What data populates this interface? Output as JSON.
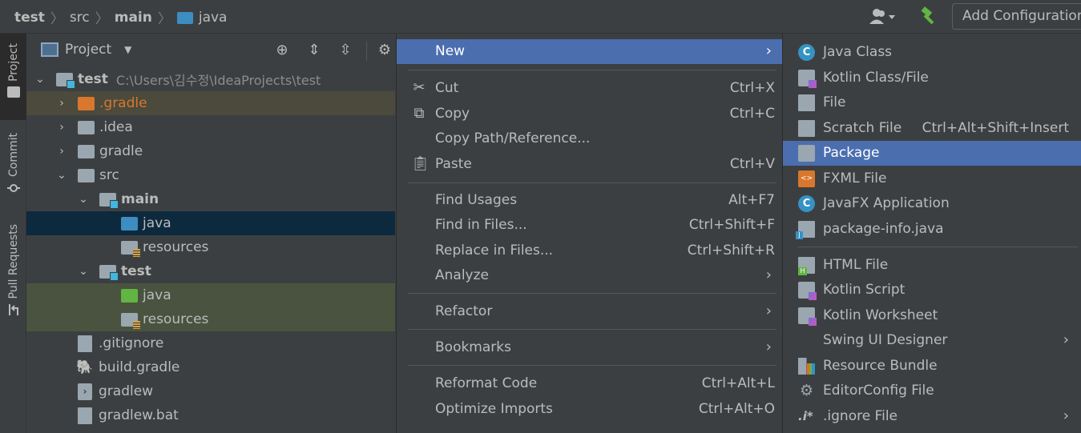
{
  "breadcrumb": {
    "items": [
      {
        "label": "test",
        "bold": true
      },
      {
        "label": "src",
        "bold": false
      },
      {
        "label": "main",
        "bold": true
      },
      {
        "label": "java",
        "bold": false
      }
    ]
  },
  "toolbar": {
    "add_configuration_label": "Add Configuration..."
  },
  "toolstrip": {
    "tabs": [
      "Project",
      "Commit",
      "Pull Requests"
    ]
  },
  "project_panel": {
    "title": "Project",
    "root": {
      "name": "test",
      "path": "C:\\Users\\김수정\\IdeaProjects\\test"
    },
    "items": [
      {
        "name": ".gradle"
      },
      {
        "name": ".idea"
      },
      {
        "name": "gradle"
      },
      {
        "name": "src"
      },
      {
        "name": "main"
      },
      {
        "name": "java"
      },
      {
        "name": "resources"
      },
      {
        "name": "test"
      },
      {
        "name": "java"
      },
      {
        "name": "resources"
      },
      {
        "name": ".gitignore"
      },
      {
        "name": "build.gradle"
      },
      {
        "name": "gradlew"
      },
      {
        "name": "gradlew.bat"
      }
    ]
  },
  "context_menu": {
    "new": "New",
    "cut": {
      "label": "Cut",
      "shortcut": "Ctrl+X"
    },
    "copy": {
      "label": "Copy",
      "shortcut": "Ctrl+C"
    },
    "copy_path": {
      "label": "Copy Path/Reference..."
    },
    "paste": {
      "label": "Paste",
      "shortcut": "Ctrl+V"
    },
    "find_usages": {
      "label": "Find Usages",
      "shortcut": "Alt+F7"
    },
    "find_in_files": {
      "label": "Find in Files...",
      "shortcut": "Ctrl+Shift+F"
    },
    "replace_in_files": {
      "label": "Replace in Files...",
      "shortcut": "Ctrl+Shift+R"
    },
    "analyze": {
      "label": "Analyze"
    },
    "refactor": {
      "label": "Refactor"
    },
    "bookmarks": {
      "label": "Bookmarks"
    },
    "reformat_code": {
      "label": "Reformat Code",
      "shortcut": "Ctrl+Alt+L"
    },
    "optimize_imports": {
      "label": "Optimize Imports",
      "shortcut": "Ctrl+Alt+O"
    }
  },
  "new_submenu": {
    "java_class": "Java Class",
    "kotlin_class": "Kotlin Class/File",
    "file": "File",
    "scratch_file": {
      "label": "Scratch File",
      "shortcut": "Ctrl+Alt+Shift+Insert"
    },
    "package": "Package",
    "fxml_file": "FXML File",
    "javafx_app": "JavaFX Application",
    "package_info": "package-info.java",
    "html_file": "HTML File",
    "kotlin_script": "Kotlin Script",
    "kotlin_worksheet": "Kotlin Worksheet",
    "swing_ui": "Swing UI Designer",
    "resource_bundle": "Resource Bundle",
    "editorconfig": "EditorConfig File",
    "ignore_file": ".ignore File"
  },
  "colors": {
    "highlight": "#4b6eaf",
    "selection": "#0d293e",
    "background": "#3c3f41"
  }
}
